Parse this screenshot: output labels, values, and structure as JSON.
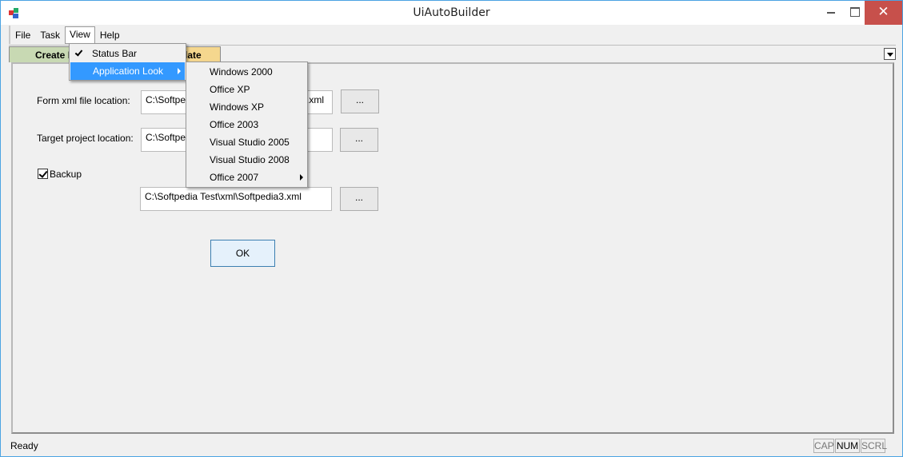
{
  "window": {
    "title": "UiAutoBuilder",
    "close_symbol": "✕"
  },
  "menubar": {
    "items": [
      "File",
      "Task",
      "View",
      "Help"
    ]
  },
  "tabs": {
    "create_label": "Create R",
    "update_label": "late"
  },
  "form": {
    "xml_label": "Form xml file location:",
    "xml_value": "C:\\Softpedia Test\\xml\\Softpedia3.xml",
    "xml_visible_start": "C:\\Softpe",
    "xml_visible_end": ".xml",
    "target_label": "Target project location:",
    "target_visible": "C:\\Softpe",
    "backup_label": "Backup",
    "backup_checked": true,
    "backup_value": "C:\\Softpedia Test\\xml\\Softpedia3.xml",
    "browse_label": "...",
    "ok_label": "OK"
  },
  "view_menu": {
    "items": [
      {
        "label": "Status Bar",
        "checked": true
      },
      {
        "label": "Application Look",
        "submenu": true,
        "highlighted": true
      }
    ]
  },
  "look_menu": {
    "items": [
      "Windows 2000",
      "Office XP",
      "Windows XP",
      "Office 2003",
      "Visual Studio 2005",
      "Visual Studio 2008",
      "Office 2007"
    ]
  },
  "statusbar": {
    "text": "Ready",
    "indicators": [
      "CAP",
      "NUM",
      "SCRL"
    ]
  },
  "colors": {
    "menu_highlight": "#3399ff",
    "close_button": "#c7504b",
    "tab_create": "#c8d9b3",
    "tab_update": "#f5d78e"
  },
  "icons": [
    "app-icon",
    "checkmark-icon",
    "submenu-arrow-icon",
    "dropdown-arrow-icon",
    "minimize-icon",
    "maximize-icon",
    "close-icon"
  ]
}
